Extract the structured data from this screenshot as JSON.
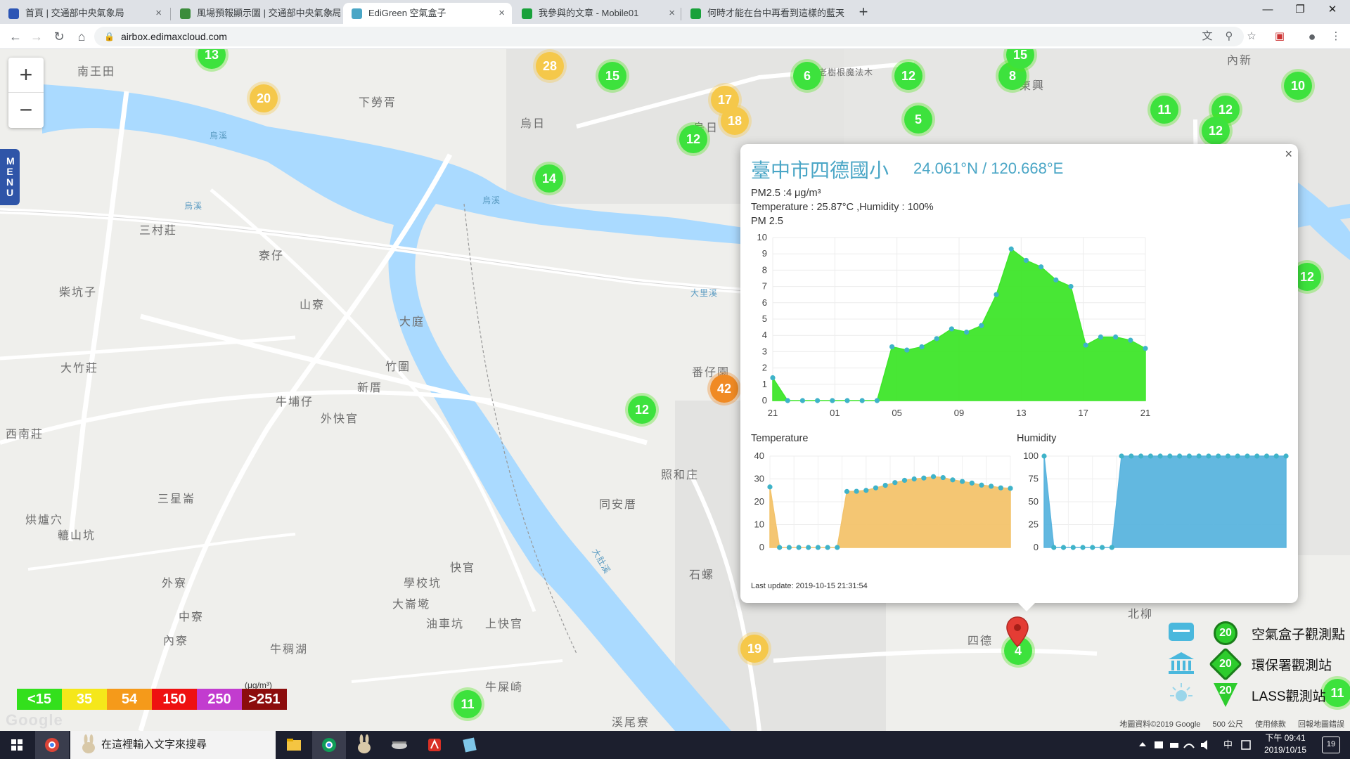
{
  "browser": {
    "tabs": [
      {
        "label": "首頁 | 交通部中央氣象局",
        "close": "×"
      },
      {
        "label": "風場預報顯示圖 | 交通部中央氣象局",
        "close": "×"
      },
      {
        "label": "EdiGreen 空氣盒子",
        "close": "×"
      },
      {
        "label": "我參與的文章 - Mobile01",
        "close": "×"
      },
      {
        "label": "何時才能在台中再看到這樣的藍天",
        "close": "×"
      }
    ],
    "new_tab": "+",
    "url": "airbox.edimaxcloud.com",
    "window_controls": [
      "—",
      "❐",
      "✕"
    ]
  },
  "map": {
    "menu_label": "MENU",
    "zoom_in": "+",
    "zoom_out": "−",
    "places": [
      "南王田",
      "下勞胥",
      "烏日",
      "東興",
      "內新",
      "三村莊",
      "寮仔",
      "柴坑子",
      "山寮",
      "大庭",
      "竹圍",
      "大竹莊",
      "新厝",
      "牛埔仔",
      "外快官",
      "西南莊",
      "三星崙",
      "同安厝",
      "烘爐穴",
      "轆山坑",
      "照和庄",
      "外寮",
      "學校坑",
      "大崙墘",
      "快官",
      "中寮",
      "油車坑",
      "上快官",
      "內寮",
      "牛稠湖",
      "牛屎崎",
      "溪尾寮",
      "四德",
      "番仔園",
      "老樹根魔法木",
      "烏日",
      "北柳",
      "石螺"
    ],
    "rivers": [
      "烏溪",
      "烏溪",
      "大里溪",
      "烏溪",
      "大肚溪"
    ],
    "clusters": [
      {
        "v": "13",
        "c": "g"
      },
      {
        "v": "20",
        "c": "y"
      },
      {
        "v": "28",
        "c": "y"
      },
      {
        "v": "15",
        "c": "g"
      },
      {
        "v": "17",
        "c": "y"
      },
      {
        "v": "18",
        "c": "y"
      },
      {
        "v": "6",
        "c": "g"
      },
      {
        "v": "12",
        "c": "g"
      },
      {
        "v": "8",
        "c": "g"
      },
      {
        "v": "15",
        "c": "g"
      },
      {
        "v": "5",
        "c": "g"
      },
      {
        "v": "11",
        "c": "g"
      },
      {
        "v": "12",
        "c": "g"
      },
      {
        "v": "12",
        "c": "g"
      },
      {
        "v": "10",
        "c": "g"
      },
      {
        "v": "12",
        "c": "g"
      },
      {
        "v": "14",
        "c": "g"
      },
      {
        "v": "12",
        "c": "g"
      },
      {
        "v": "42",
        "c": "o"
      },
      {
        "v": "12",
        "c": "g"
      },
      {
        "v": "19",
        "c": "y"
      },
      {
        "v": "11",
        "c": "g"
      },
      {
        "v": "4",
        "c": "g"
      },
      {
        "v": "11",
        "c": "g"
      }
    ],
    "legend": [
      {
        "label": "<15",
        "color": "#33e01c"
      },
      {
        "label": "35",
        "color": "#f5e71a"
      },
      {
        "label": "54",
        "color": "#f59a1a"
      },
      {
        "label": "150",
        "color": "#ee1111"
      },
      {
        "label": "250",
        "color": "#c23ccf"
      },
      {
        "label": ">251",
        "color": "#8c0d0d"
      }
    ],
    "legend_unit": "(μg/m³)",
    "google": "Google",
    "footer": [
      "地圖資料©2019 Google",
      "500 公尺",
      "使用條款",
      "回報地圖錯誤"
    ],
    "station_keys": [
      {
        "badge": "20",
        "label": "空氣盒子觀測點",
        "icon": "airbox-icon"
      },
      {
        "badge": "20",
        "label": "環保署觀測站",
        "icon": "government-building-icon"
      },
      {
        "badge": "20",
        "label": "LASS觀測站",
        "icon": "lass-sun-icon"
      }
    ],
    "selected_marker_value": "4"
  },
  "popup": {
    "close": "×",
    "title": "臺中市四德國小",
    "coords": "24.061°N / 120.668°E",
    "pm25_line": "PM2.5 :4 μg/m³",
    "temp_line": "Temperature : 25.87°C ,Humidity : 100%",
    "chart_title": "PM 2.5",
    "temp_title": "Temperature",
    "hum_title": "Humidity",
    "last_update": "Last update: 2019-10-15 21:31:54"
  },
  "chart_data": [
    {
      "type": "area",
      "title": "PM 2.5",
      "x_ticks": [
        "21",
        "01",
        "05",
        "09",
        "13",
        "17",
        "21"
      ],
      "ylim": [
        0,
        10
      ],
      "y_ticks": [
        0,
        1,
        2,
        3,
        4,
        5,
        6,
        7,
        8,
        9,
        10
      ],
      "values": [
        1.4,
        0.0,
        0.0,
        0.0,
        0.0,
        0.0,
        0.0,
        0.0,
        3.3,
        3.1,
        3.3,
        3.8,
        4.4,
        4.2,
        4.6,
        6.5,
        9.3,
        8.6,
        8.2,
        7.4,
        7.0,
        3.4,
        3.9,
        3.9,
        3.7,
        3.2
      ],
      "color": "#3ee62a",
      "grid": true
    },
    {
      "type": "area",
      "title": "Temperature",
      "ylim": [
        0,
        40
      ],
      "y_ticks": [
        0,
        10,
        20,
        30,
        40
      ],
      "values": [
        26.5,
        0,
        0,
        0,
        0,
        0,
        0,
        0,
        24.5,
        24.6,
        25.0,
        26.1,
        27.2,
        28.4,
        29.4,
        30.0,
        30.4,
        31.0,
        30.6,
        29.6,
        28.9,
        28.2,
        27.3,
        26.8,
        26.1,
        25.9
      ],
      "color": "#f3c36b",
      "grid": true
    },
    {
      "type": "area",
      "title": "Humidity",
      "ylim": [
        0,
        100
      ],
      "y_ticks": [
        0,
        25,
        50,
        75,
        100
      ],
      "values": [
        100,
        0,
        0,
        0,
        0,
        0,
        0,
        0,
        100,
        100,
        100,
        100,
        100,
        100,
        100,
        100,
        100,
        100,
        100,
        100,
        100,
        100,
        100,
        100,
        100,
        100
      ],
      "color": "#5ab4de",
      "grid": true
    }
  ],
  "taskbar": {
    "search_placeholder": "在這裡輸入文字來搜尋",
    "time": "下午 09:41",
    "date": "2019/10/15",
    "ime": "中",
    "notif": "19"
  }
}
